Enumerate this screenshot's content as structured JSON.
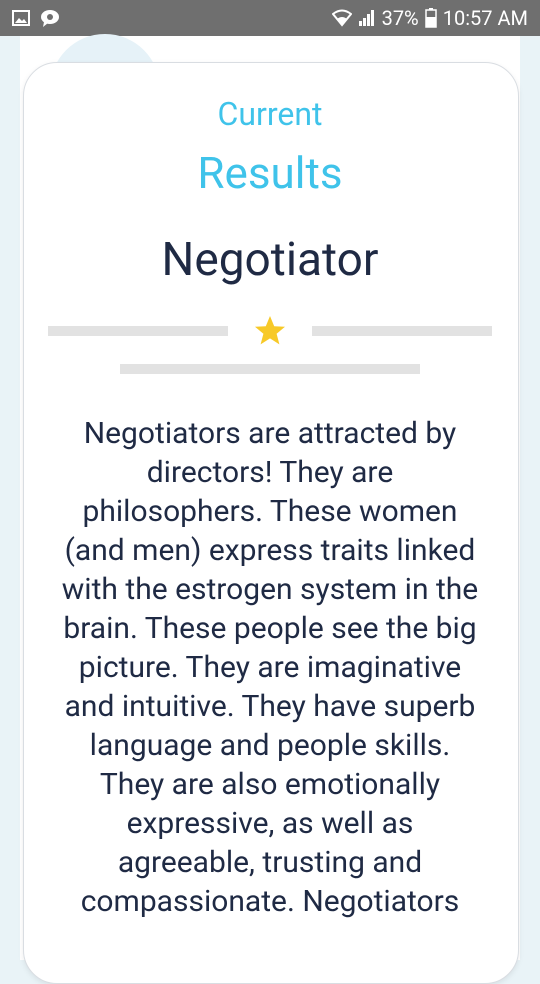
{
  "status_bar": {
    "battery_percent": "37%",
    "time": "10:57 AM",
    "icons": [
      "image-icon",
      "chat-bubble-icon",
      "wifi-icon",
      "signal-icon",
      "battery-icon"
    ]
  },
  "result": {
    "heading_line1": "Current",
    "heading_line2": "Results",
    "type_name": "Negotiator",
    "rating_icon": "star-icon",
    "description": "Negotiators are attracted by directors! They are philosophers. These women (and men) express traits linked with the estrogen system in the brain. These people see the big picture. They are imaginative and intuitive. They have superb language and people skills. They are also emotionally expressive, as well as agreeable, trusting and compassionate. Negotiators"
  },
  "colors": {
    "status_bar_bg": "#6f6f6f",
    "accent": "#3fc3ea",
    "text_dark": "#1f2a44",
    "star": "#f7c928",
    "divider": "#e2e2e2"
  }
}
